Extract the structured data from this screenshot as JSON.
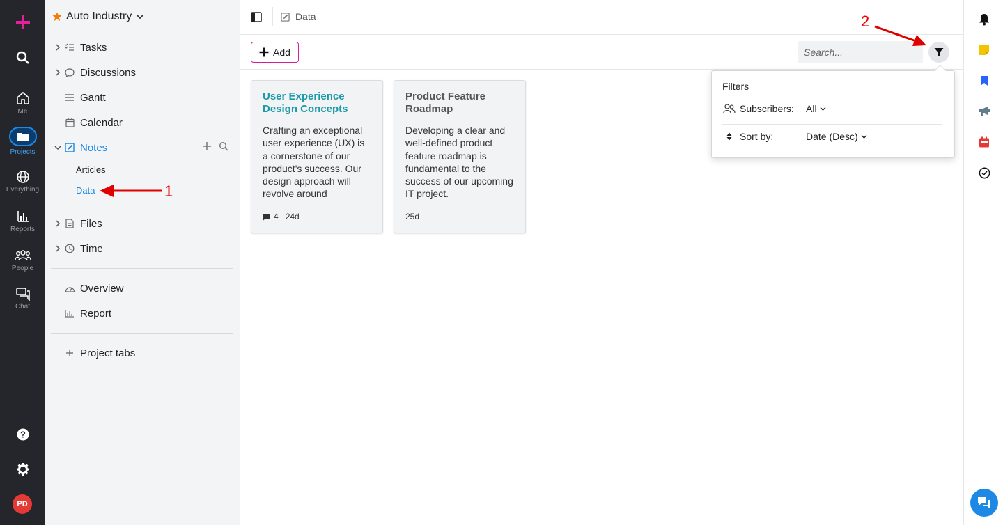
{
  "rail": {
    "items": [
      {
        "label": "Me"
      },
      {
        "label": "Projects"
      },
      {
        "label": "Everything"
      },
      {
        "label": "Reports"
      },
      {
        "label": "People"
      },
      {
        "label": "Chat"
      }
    ],
    "avatar": "PD",
    "active_color": "#1e88e5"
  },
  "sidebar": {
    "project_title": "Auto Industry",
    "items": [
      {
        "label": "Tasks"
      },
      {
        "label": "Discussions"
      },
      {
        "label": "Gantt"
      },
      {
        "label": "Calendar"
      },
      {
        "label": "Notes"
      },
      {
        "label": "Files"
      },
      {
        "label": "Time"
      },
      {
        "label": "Overview"
      },
      {
        "label": "Report"
      },
      {
        "label": "Project tabs"
      }
    ],
    "notes_sub": [
      "Articles",
      "Data"
    ]
  },
  "header": {
    "breadcrumb": "Data"
  },
  "toolbar": {
    "add_label": "Add",
    "search_placeholder": "Search..."
  },
  "cards": [
    {
      "title": "User Experience Design Concepts",
      "body": "Crafting an exceptional user experience (UX) is a cornerstone of our product's success. Our design approach will revolve around",
      "comments": "4",
      "age": "24d"
    },
    {
      "title": "Product Feature Roadmap",
      "body": "Developing a clear and well-defined product feature roadmap is fundamental to the success of our upcoming IT project.",
      "comments": "",
      "age": "25d"
    }
  ],
  "filters": {
    "title": "Filters",
    "subscribers_label": "Subscribers:",
    "subscribers_value": "All",
    "sort_label": "Sort by:",
    "sort_value": "Date (Desc)"
  },
  "annotations": {
    "one": "1",
    "two": "2"
  },
  "colors": {
    "brand_pink": "#e91e9c",
    "accent_blue": "#1e88e5",
    "teal_title": "#1a9aa8",
    "annotation_red": "#e00000"
  }
}
